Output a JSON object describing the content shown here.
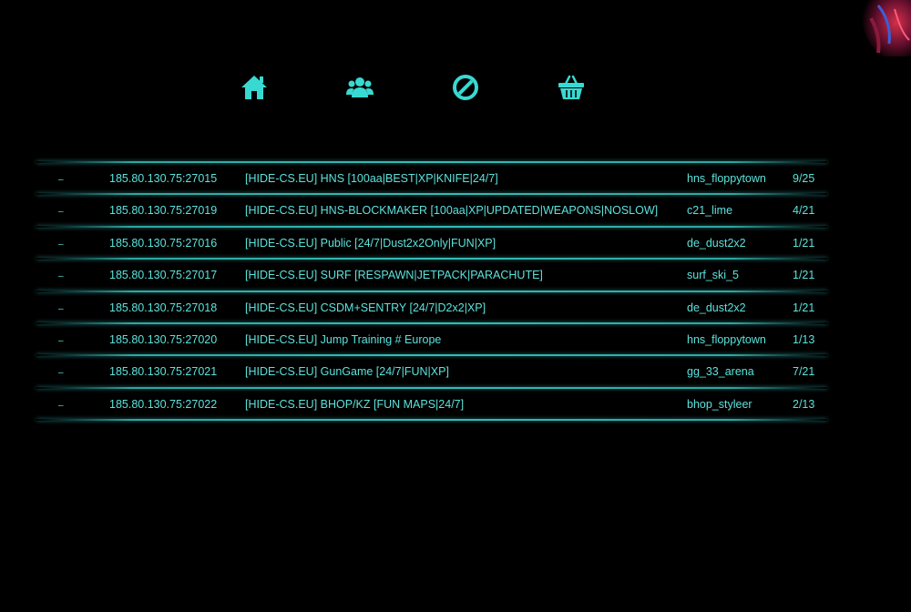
{
  "theme": {
    "accent": "#5be3dc",
    "background": "#000000"
  },
  "nav": {
    "items": [
      {
        "icon": "home-icon",
        "label": "Home"
      },
      {
        "icon": "users-icon",
        "label": "Players"
      },
      {
        "icon": "ban-icon",
        "label": "Bans"
      },
      {
        "icon": "shop-basket-icon",
        "label": "Shop"
      }
    ]
  },
  "servers": [
    {
      "ping": "–",
      "ip": "185.80.130.75:27015",
      "name": "[HIDE-CS.EU] HNS [100aa|BEST|XP|KNIFE|24/7]",
      "map": "hns_floppytown",
      "players": "9/25"
    },
    {
      "ping": "–",
      "ip": "185.80.130.75:27019",
      "name": "[HIDE-CS.EU] HNS-BLOCKMAKER [100aa|XP|UPDATED|WEAPONS|NOSLOW]",
      "map": "c21_lime",
      "players": "4/21"
    },
    {
      "ping": "–",
      "ip": "185.80.130.75:27016",
      "name": "[HIDE-CS.EU] Public [24/7|Dust2x2Only|FUN|XP]",
      "map": "de_dust2x2",
      "players": "1/21"
    },
    {
      "ping": "–",
      "ip": "185.80.130.75:27017",
      "name": "[HIDE-CS.EU] SURF [RESPAWN|JETPACK|PARACHUTE]",
      "map": "surf_ski_5",
      "players": "1/21"
    },
    {
      "ping": "–",
      "ip": "185.80.130.75:27018",
      "name": "[HIDE-CS.EU] CSDM+SENTRY [24/7|D2x2|XP]",
      "map": "de_dust2x2",
      "players": "1/21"
    },
    {
      "ping": "–",
      "ip": "185.80.130.75:27020",
      "name": "[HIDE-CS.EU] Jump Training # Europe",
      "map": "hns_floppytown",
      "players": "1/13"
    },
    {
      "ping": "–",
      "ip": "185.80.130.75:27021",
      "name": "[HIDE-CS.EU] GunGame [24/7|FUN|XP]",
      "map": "gg_33_arena",
      "players": "7/21"
    },
    {
      "ping": "–",
      "ip": "185.80.130.75:27022",
      "name": "[HIDE-CS.EU] BHOP/KZ [FUN MAPS|24/7]",
      "map": "bhop_styleer",
      "players": "2/13"
    }
  ]
}
